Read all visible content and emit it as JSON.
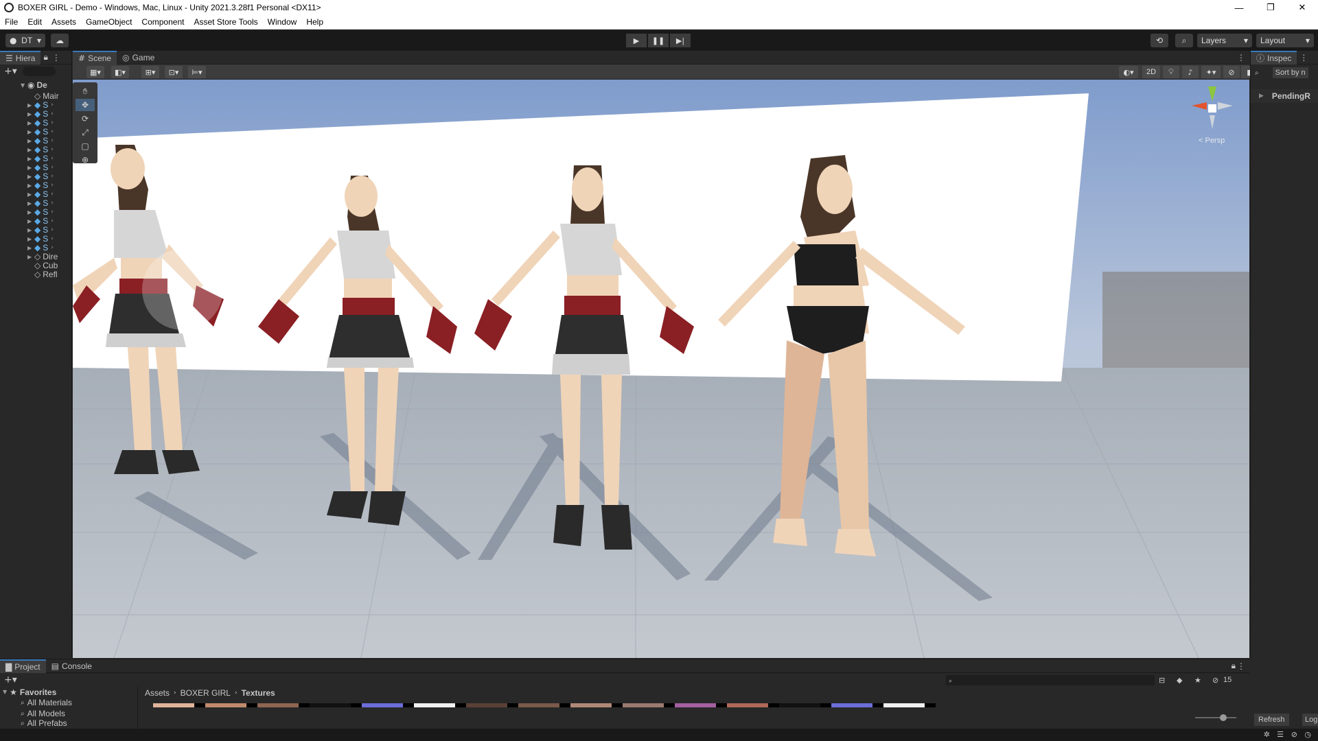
{
  "window": {
    "title": "BOXER GIRL - Demo - Windows, Mac, Linux - Unity 2021.3.28f1 Personal <DX11>",
    "minimize": "—",
    "maximize": "❐",
    "close": "✕"
  },
  "menu": [
    "File",
    "Edit",
    "Assets",
    "GameObject",
    "Component",
    "Asset Store Tools",
    "Window",
    "Help"
  ],
  "toolbar": {
    "account_label": "DT",
    "layers_label": "Layers",
    "layout_label": "Layout"
  },
  "hierarchy": {
    "tab_label": "Hiera",
    "root_label": "De",
    "items": [
      "Mair",
      "S",
      "S",
      "S",
      "S",
      "S",
      "S",
      "S",
      "S",
      "S",
      "S",
      "S",
      "S",
      "S",
      "S",
      "S",
      "S",
      "S",
      "Dire",
      "Cub",
      "Refl"
    ]
  },
  "scene": {
    "tabs": [
      {
        "label": "Scene",
        "active": true
      },
      {
        "label": "Game",
        "active": false
      }
    ],
    "toggle_2d": "2D",
    "gizmo_label": "< Persp"
  },
  "inspector": {
    "tab_label": "Inspec",
    "sort_label": "Sort by n",
    "pending_label": "PendingR",
    "refresh_label": "Refresh",
    "log_label": "Log"
  },
  "project": {
    "tabs": [
      {
        "label": "Project",
        "active": true
      },
      {
        "label": "Console",
        "active": false
      }
    ],
    "favorites_label": "Favorites",
    "favorites": [
      "All Materials",
      "All Models",
      "All Prefabs"
    ],
    "breadcrumb": [
      "Assets",
      "BOXER GIRL",
      "Textures"
    ],
    "hidden_count": "15"
  },
  "colors": {
    "accent": "#3a79bb",
    "panel": "#282828",
    "toolbar": "#191919",
    "sky": "#8fa6c8",
    "floor": "#bcc1c8",
    "glove": "#8a1f24"
  }
}
